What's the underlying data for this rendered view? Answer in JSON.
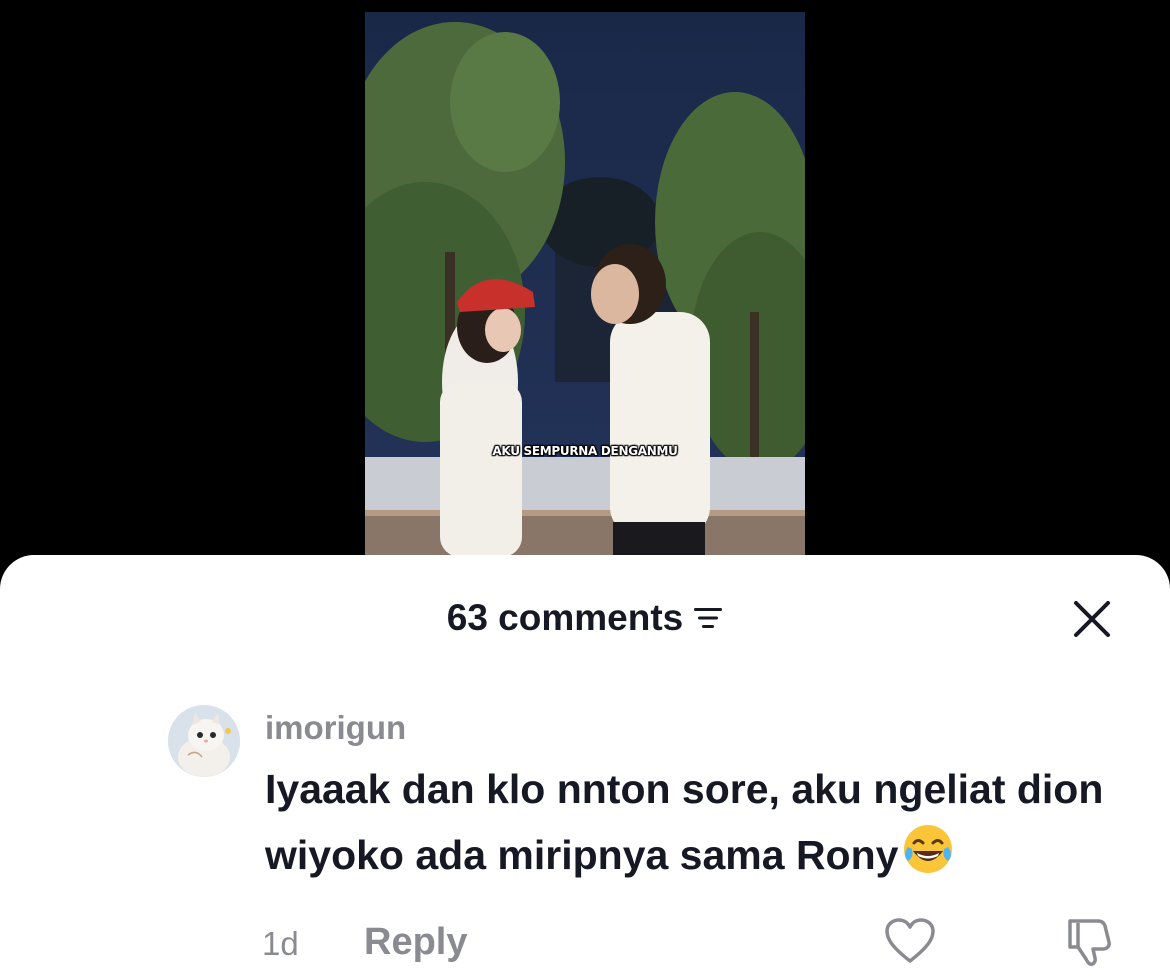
{
  "video": {
    "caption": "AKU SEMPURNA DENGANMU"
  },
  "comments_sheet": {
    "count_label": "63 comments",
    "filter_icon": "sort-lines-icon",
    "close_icon": "close-x-icon",
    "comment": {
      "username": "imorigun",
      "text": "Iyaaak dan klo nnton sore, aku ngeliat dion wiyoko ada miripnya sama Rony",
      "emoji": "😂",
      "time": "1d",
      "reply_label": "Reply",
      "like_icon": "heart-outline-icon",
      "dislike_icon": "thumbs-down-outline-icon"
    }
  },
  "colors": {
    "primary_text": "#161823",
    "secondary_text": "#8a8b91",
    "sheet_background": "#ffffff",
    "page_background": "#000000"
  }
}
